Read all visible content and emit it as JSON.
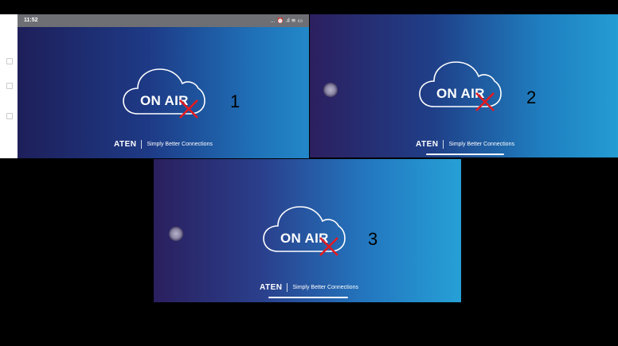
{
  "panels": [
    {
      "number": "1",
      "on_air": "ON AIR",
      "brand_logo": "ATEN",
      "brand_tagline": "Simply Better Connections",
      "status_time": "11:52",
      "status_icons": "... ⏰ .ıl ≋ ▭"
    },
    {
      "number": "2",
      "on_air": "ON AIR",
      "brand_logo": "ATEN",
      "brand_tagline": "Simply Better Connections"
    },
    {
      "number": "3",
      "on_air": "ON AIR",
      "brand_logo": "ATEN",
      "brand_tagline": "Simply Better Connections"
    }
  ],
  "colors": {
    "x_mark": "#e11b22",
    "gradient_start": "#1e1f5a",
    "gradient_end": "#26a0d6"
  },
  "icons": [
    "cloud-icon",
    "x-mark-icon",
    "floating-dot-icon"
  ]
}
